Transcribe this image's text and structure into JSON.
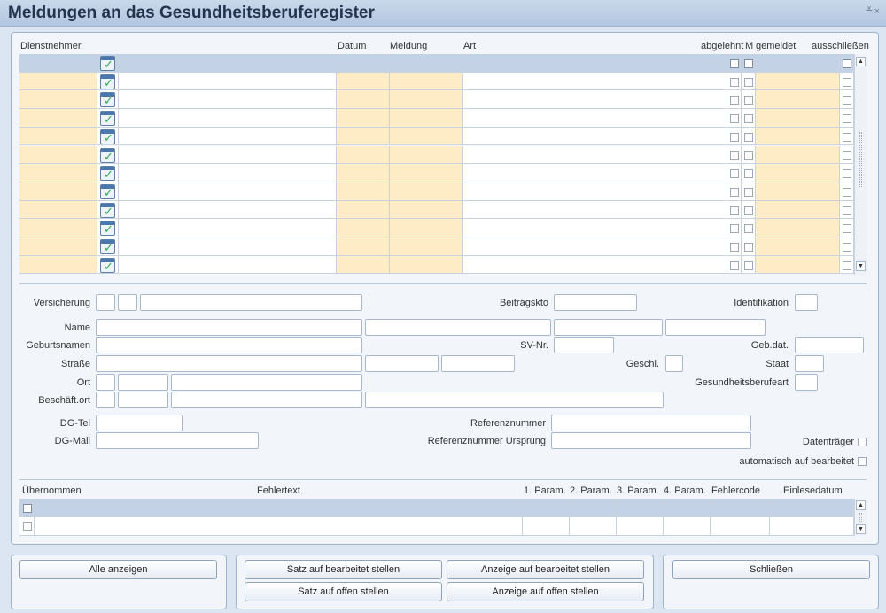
{
  "window": {
    "title": "Meldungen an das Gesundheitsberuferegister",
    "controls": "≚×"
  },
  "top_grid": {
    "columns": {
      "dienstnehmer": "Dienstnehmer",
      "datum": "Datum",
      "meldung": "Meldung",
      "art": "Art",
      "abgelehnt": "abgelehnt",
      "m": "M",
      "gemeldet": "gemeldet",
      "ausschliessen": "ausschließen"
    },
    "row_count": 11
  },
  "form": {
    "versicherung": "Versicherung",
    "beitragskto": "Beitragskto",
    "identifikation": "Identifikation",
    "name": "Name",
    "geburtsnamen": "Geburtsnamen",
    "sv_nr": "SV-Nr.",
    "geb_dat": "Geb.dat.",
    "strasse": "Straße",
    "geschl": "Geschl.",
    "staat": "Staat",
    "ort": "Ort",
    "gesundheitsberufeart": "Gesundheitsberufeart",
    "beschaeft_ort": "Beschäft.ort",
    "dg_tel": "DG-Tel",
    "referenznummer": "Referenznummer",
    "dg_mail": "DG-Mail",
    "referenznummer_ursprung": "Referenznummer Ursprung",
    "datentraeger": "Datenträger",
    "automatisch": "automatisch auf bearbeitet"
  },
  "error_grid": {
    "columns": {
      "uebernommen": "Übernommen",
      "fehlertext": "Fehlertext",
      "param1": "1. Param.",
      "param2": "2. Param.",
      "param3": "3. Param.",
      "param4": "4. Param.",
      "fehlercode": "Fehlercode",
      "einlesedatum": "Einlesedatum"
    }
  },
  "buttons": {
    "alle_anzeigen": "Alle anzeigen",
    "satz_bearbeitet": "Satz auf bearbeitet stellen",
    "anzeige_bearbeitet": "Anzeige auf bearbeitet stellen",
    "satz_offen": "Satz auf offen stellen",
    "anzeige_offen": "Anzeige auf offen stellen",
    "schliessen": "Schließen"
  }
}
